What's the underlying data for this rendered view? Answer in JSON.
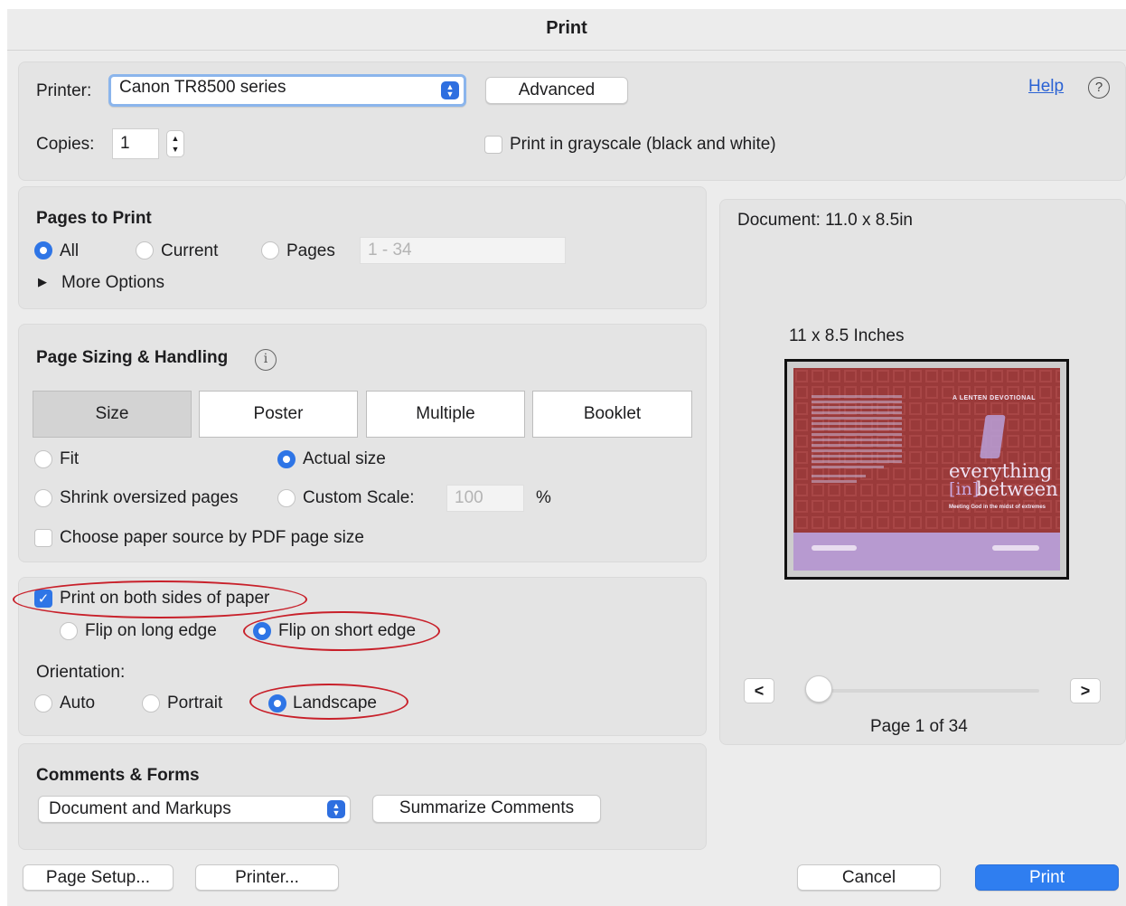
{
  "window": {
    "title": "Print"
  },
  "printer": {
    "label": "Printer:",
    "selected": "Canon TR8500 series",
    "advanced": "Advanced",
    "help": "Help",
    "help_icon": "?"
  },
  "copies": {
    "label": "Copies:",
    "value": "1"
  },
  "grayscale": {
    "label": "Print in grayscale (black and white)",
    "checked": false
  },
  "pages_to_print": {
    "heading": "Pages to Print",
    "all": "All",
    "current": "Current",
    "pages": "Pages",
    "pages_placeholder": "1 - 34",
    "more_options": "More Options"
  },
  "sizing": {
    "heading": "Page Sizing & Handling",
    "info_icon": "i",
    "tabs": [
      "Size",
      "Poster",
      "Multiple",
      "Booklet"
    ],
    "selected_tab": "Size",
    "fit": "Fit",
    "actual_size": "Actual size",
    "shrink": "Shrink oversized pages",
    "custom_scale": "Custom Scale:",
    "scale_value": "100",
    "percent": "%",
    "paper_source": "Choose paper source by PDF page size"
  },
  "duplex": {
    "both_sides": "Print on both sides of paper",
    "long_edge": "Flip on long edge",
    "short_edge": "Flip on short edge"
  },
  "orientation": {
    "label": "Orientation:",
    "auto": "Auto",
    "portrait": "Portrait",
    "landscape": "Landscape"
  },
  "comments": {
    "heading": "Comments & Forms",
    "selected": "Document and Markups",
    "summarize": "Summarize Comments"
  },
  "preview": {
    "document_size": "Document: 11.0 x 8.5in",
    "paper_size": "11 x 8.5 Inches",
    "prev": "<",
    "next": ">",
    "page_info": "Page 1 of 34",
    "thumb": {
      "kicker": "A LENTEN DEVOTIONAL",
      "title_line1": "everything",
      "title_in": "[in]",
      "title_line2": "between",
      "subtitle": "Meeting God in the midst of extremes"
    }
  },
  "footer": {
    "page_setup": "Page Setup...",
    "printer": "Printer...",
    "cancel": "Cancel",
    "print": "Print"
  },
  "colors": {
    "accent": "#2e75e6",
    "annotation": "#c8202a",
    "cover_red": "#9a3a3a",
    "cover_purple": "#b79ad0"
  }
}
